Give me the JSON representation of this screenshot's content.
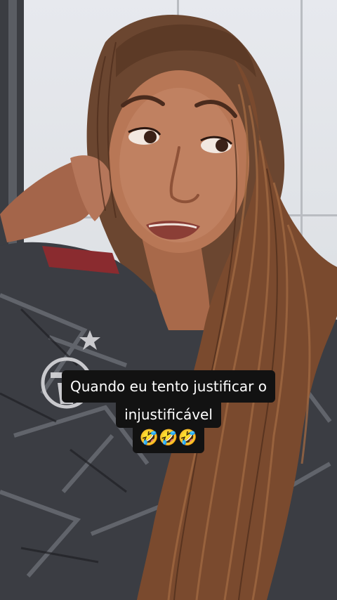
{
  "caption": {
    "line1": "Quando eu tento justificar o",
    "line2": "injustificável",
    "line3": "🤣🤣🤣"
  },
  "colors": {
    "caption_bg": "#121212",
    "caption_text": "#ffffff",
    "wall": "#e3e5e9",
    "hair": "#8a5a3a",
    "shirt": "#3d3f44"
  }
}
